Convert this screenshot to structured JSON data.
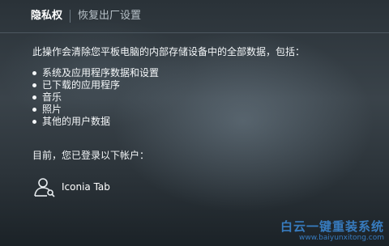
{
  "header": {
    "active_tab": "隐私权",
    "inactive_tab": "恢复出厂设置"
  },
  "content": {
    "intro": "此操作会清除您平板电脑的内部存储设备中的全部数据，包括：",
    "items": [
      "系统及应用程序数据和设置",
      "已下载的应用程序",
      "音乐",
      "照片",
      "其他的用户数据"
    ]
  },
  "account": {
    "label": "目前，您已登录以下帐户：",
    "icon": "user-icon",
    "name": "Iconia Tab"
  },
  "watermark": {
    "title": "白云一键重装系统",
    "url": "www.baiyunxitong.com"
  }
}
